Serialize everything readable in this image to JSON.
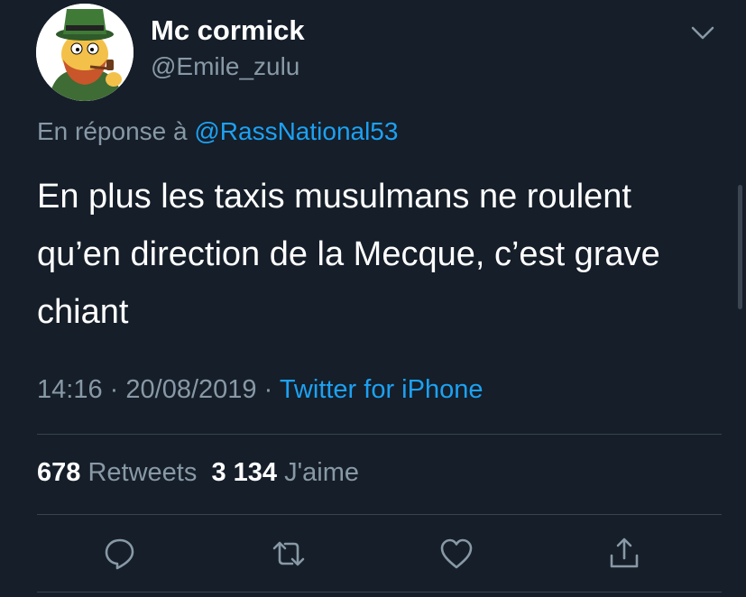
{
  "author": {
    "display_name": "Mc cormick",
    "handle": "@Emile_zulu"
  },
  "reply": {
    "prefix": "En réponse à",
    "mention": "@RassNational53"
  },
  "tweet": {
    "text": "En plus les taxis musulmans ne roulent qu’en direction de la Mecque, c’est grave chiant"
  },
  "meta": {
    "time": "14:16",
    "date": "20/08/2019",
    "separator": "·",
    "source": "Twitter for iPhone"
  },
  "stats": {
    "retweets_count": "678",
    "retweets_label": "Retweets",
    "likes_count": "3 134",
    "likes_label": "J'aime"
  },
  "actions": [
    "reply-icon",
    "retweet-icon",
    "like-icon",
    "share-icon"
  ],
  "colors": {
    "background": "#151e29",
    "text": "#ffffff",
    "secondary": "#8899a6",
    "accent": "#1da1f2",
    "divider": "#38444d"
  }
}
